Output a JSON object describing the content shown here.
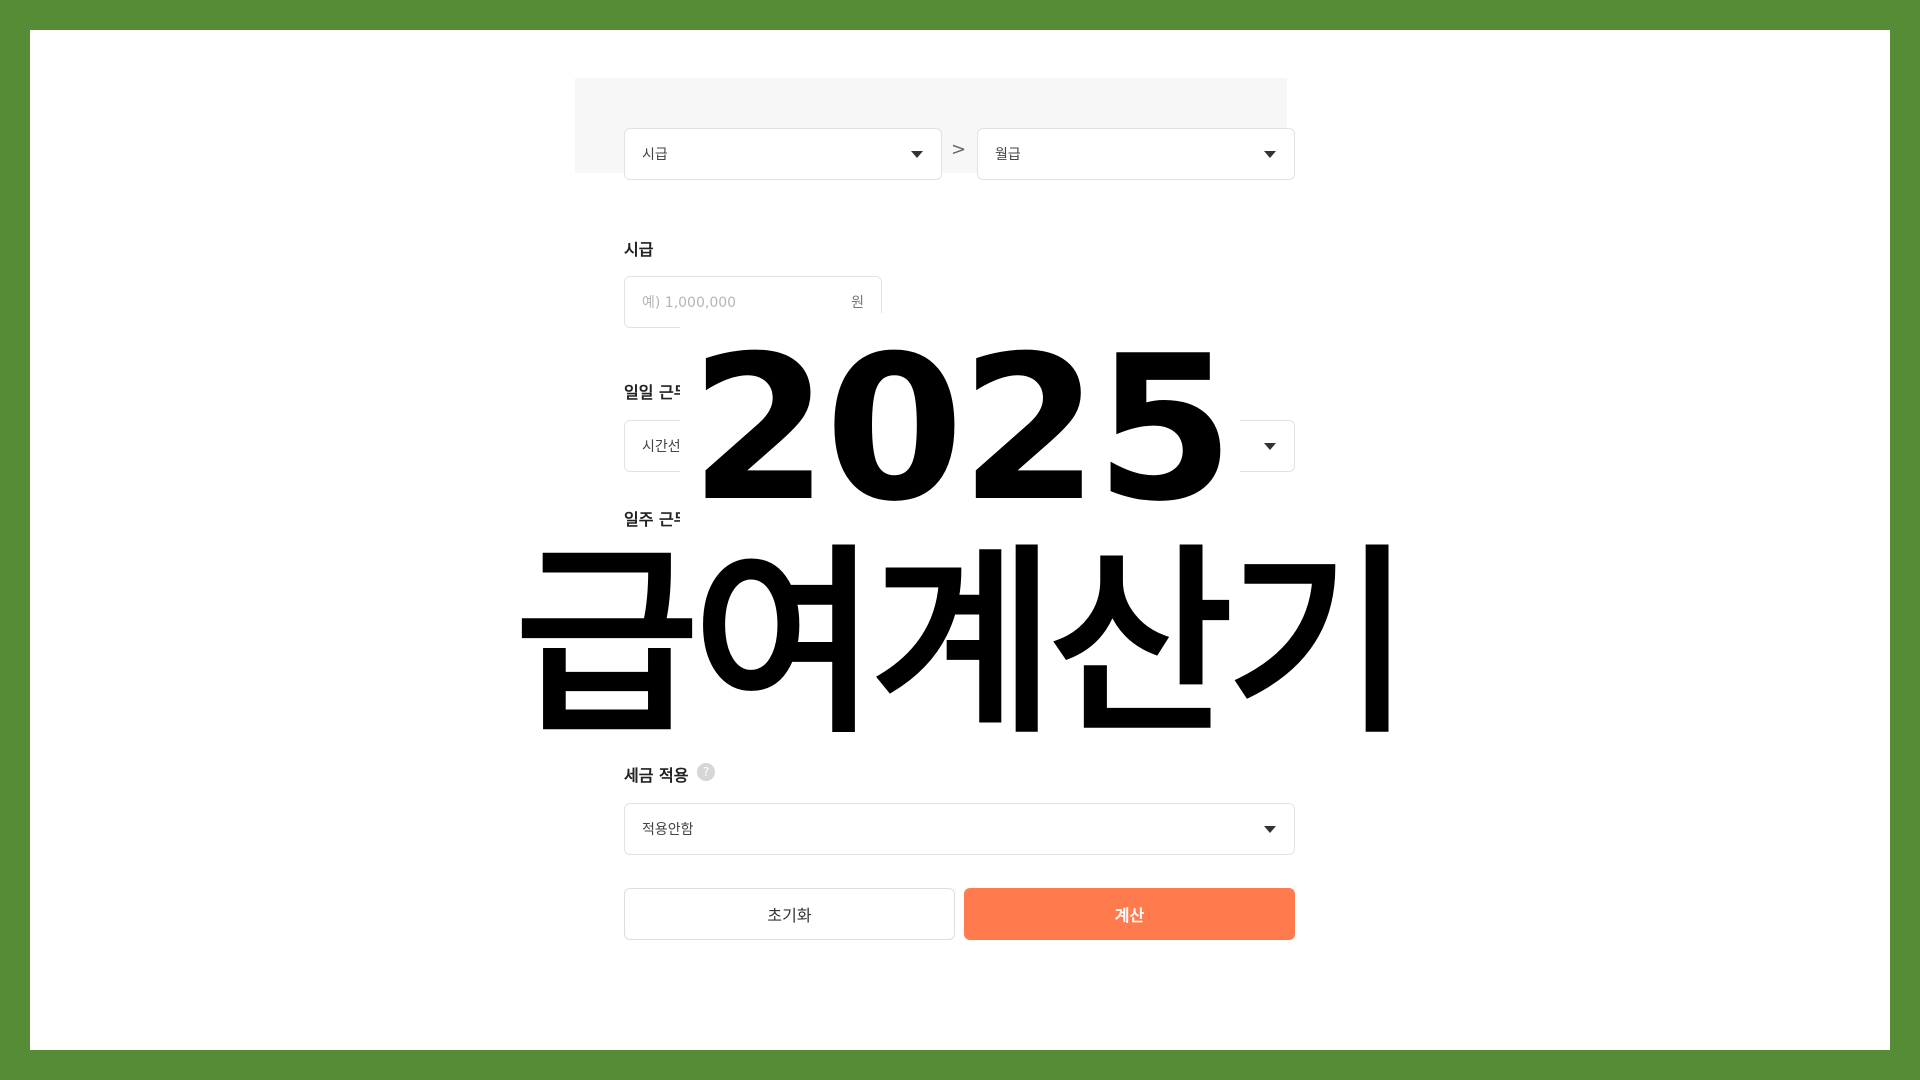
{
  "converter": {
    "from": "시급",
    "to": "월급",
    "separator": ">"
  },
  "fields": {
    "wage": {
      "label": "시급",
      "placeholder": "예) 1,000,000",
      "unit": "원"
    },
    "daily_hours": {
      "label": "일일 근무시간",
      "value": "시간선택"
    },
    "weekly_days": {
      "label": "일주 근무일수",
      "value": ""
    },
    "tax": {
      "label": "세금 적용",
      "help": "?",
      "value": "적용안함"
    }
  },
  "buttons": {
    "reset": "초기화",
    "calculate": "계산"
  },
  "overlay": {
    "year": "2025",
    "title": "급여계산기"
  },
  "colors": {
    "border_frame": "#568c35",
    "accent": "#ff7a4c"
  }
}
